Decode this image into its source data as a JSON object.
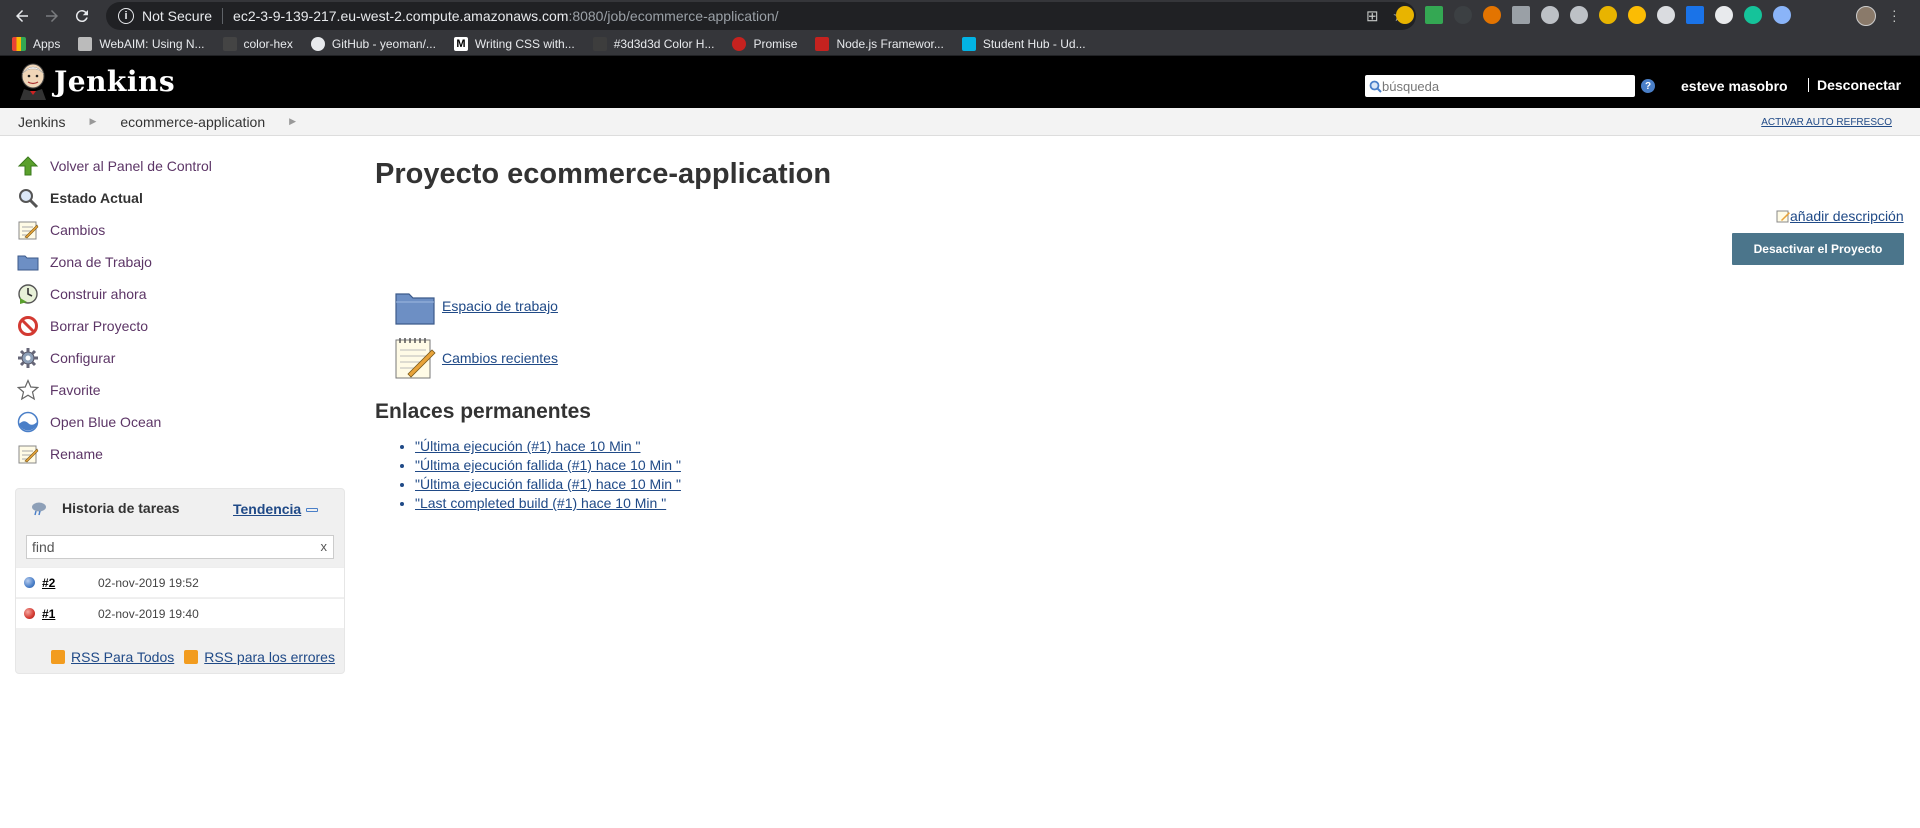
{
  "browser": {
    "security_label": "Not Secure",
    "url_host": "ec2-3-9-139-217.eu-west-2.compute.amazonaws.com",
    "url_path": ":8080/job/ecommerce-application/",
    "bookmarks": [
      "Apps",
      "WebAIM: Using N...",
      "color-hex",
      "GitHub - yeoman/...",
      "Writing CSS with...",
      "#3d3d3d Color H...",
      "Promise",
      "Node.js Framewor...",
      "Student Hub - Ud..."
    ]
  },
  "header": {
    "app_title": "Jenkins",
    "search_placeholder": "búsqueda",
    "help_glyph": "?",
    "user_name": "esteve masobro",
    "logout_label": "Desconectar"
  },
  "breadcrumb": {
    "items": [
      "Jenkins",
      "ecommerce-application"
    ],
    "refresh_label": "ACTIVAR AUTO REFRESCO"
  },
  "sidebar": {
    "tasks": [
      {
        "label": "Volver al Panel de Control",
        "icon": "up-arrow-icon"
      },
      {
        "label": "Estado Actual",
        "icon": "magnifier-icon"
      },
      {
        "label": "Cambios",
        "icon": "notepad-icon"
      },
      {
        "label": "Zona de Trabajo",
        "icon": "folder-icon"
      },
      {
        "label": "Construir ahora",
        "icon": "clock-play-icon"
      },
      {
        "label": "Borrar Proyecto",
        "icon": "no-entry-icon"
      },
      {
        "label": "Configurar",
        "icon": "gear-icon"
      },
      {
        "label": "Favorite",
        "icon": "star-icon"
      },
      {
        "label": "Open Blue Ocean",
        "icon": "blue-ocean-icon"
      },
      {
        "label": "Rename",
        "icon": "notepad-icon"
      }
    ]
  },
  "build_history": {
    "title": "Historia de tareas",
    "trend_label": "Tendencia",
    "find_placeholder": "find",
    "clear_glyph": "x",
    "builds": [
      {
        "number": "#2",
        "date": "02-nov-2019 19:52",
        "status_color": "#4a7fc8"
      },
      {
        "number": "#1",
        "date": "02-nov-2019 19:40",
        "status_color": "#d33a32"
      }
    ],
    "rss_all": "RSS Para Todos",
    "rss_failures": "RSS para los errores"
  },
  "main": {
    "title": "Proyecto ecommerce-application",
    "add_description": "añadir descripción",
    "disable_button": "Desactivar el Proyecto",
    "workspace_link": "Espacio de trabajo",
    "changes_link": "Cambios recientes",
    "permalinks_title": "Enlaces permanentes",
    "permalinks": [
      "\"Última ejecución (#1) hace 10 Min \"",
      "\"Última ejecución fallida (#1) hace 10 Min \"",
      "\"Última ejecución fallida (#1) hace 10 Min \"",
      "\"Last completed build (#1) hace 10 Min \""
    ]
  },
  "colors": {
    "header_bg": "#000000",
    "link": "#204a87",
    "button_bg": "#4b758b"
  }
}
